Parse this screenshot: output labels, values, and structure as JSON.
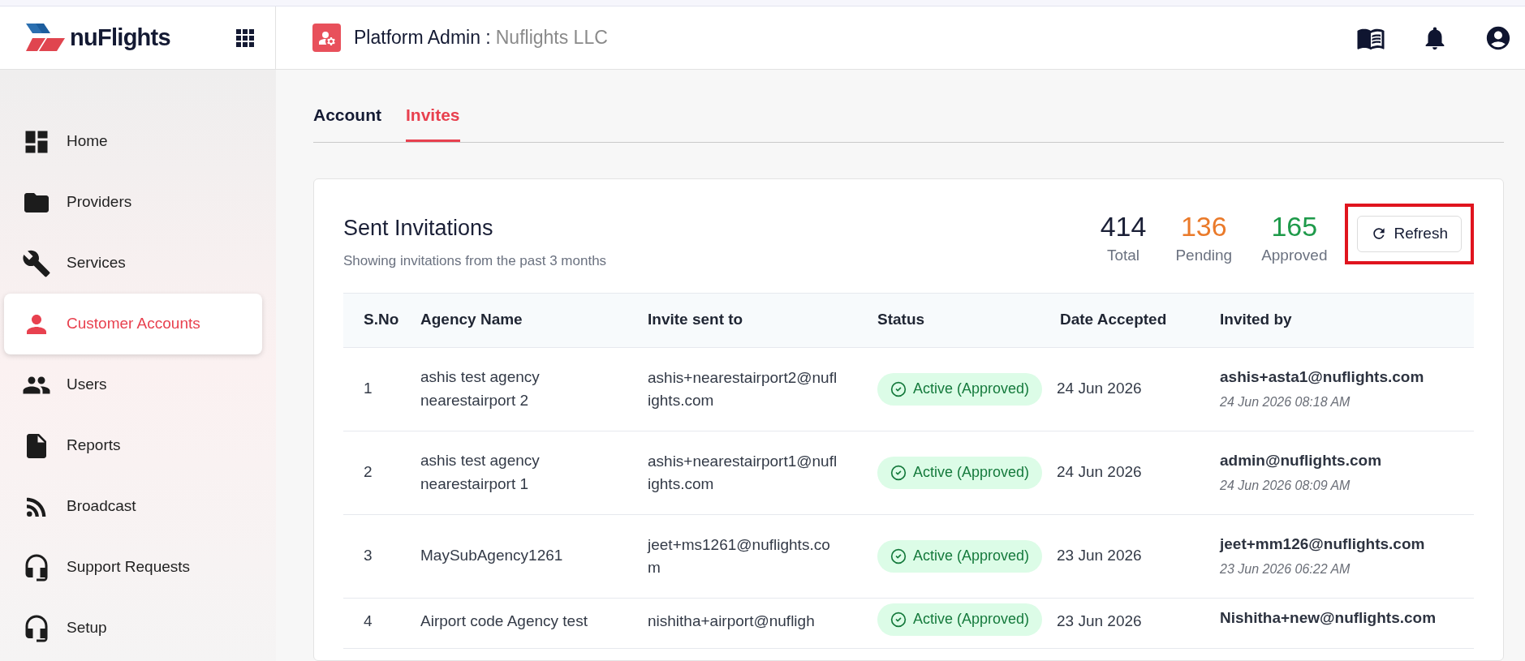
{
  "brand": {
    "name": "nuFlights"
  },
  "header": {
    "title": "Platform Admin :",
    "organization": "Nuflights LLC"
  },
  "sidebar": {
    "items": [
      {
        "label": "Home",
        "selected": false
      },
      {
        "label": "Providers",
        "selected": false
      },
      {
        "label": "Services",
        "selected": false
      },
      {
        "label": "Customer Accounts",
        "selected": true
      },
      {
        "label": "Users",
        "selected": false
      },
      {
        "label": "Reports",
        "selected": false
      },
      {
        "label": "Broadcast",
        "selected": false
      },
      {
        "label": "Support Requests",
        "selected": false
      },
      {
        "label": "Setup",
        "selected": false
      }
    ]
  },
  "tabs": [
    {
      "label": "Account",
      "selected": false
    },
    {
      "label": "Invites",
      "selected": true
    }
  ],
  "card": {
    "title": "Sent Invitations",
    "subtitle": "Showing invitations from the past 3 months",
    "stats": [
      {
        "value": "414",
        "label": "Total",
        "color": "#1a1f36"
      },
      {
        "value": "136",
        "label": "Pending",
        "color": "#ea7a2a"
      },
      {
        "value": "165",
        "label": "Approved",
        "color": "#1e9a4a"
      }
    ],
    "refresh": {
      "label": "Refresh",
      "highlighted": true
    }
  },
  "table": {
    "columns": [
      "S.No",
      "Agency Name",
      "Invite sent to",
      "Status",
      "Date Accepted",
      "Invited by"
    ],
    "rows": [
      {
        "sno": "1",
        "agency": "ashis test agency nearestairport 2",
        "email": "ashis+nearestairport2@nuflights.com",
        "status": "Active (Approved)",
        "date": "24 Jun 2026",
        "invited_by": "ashis+asta1@nuflights.com",
        "invited_at": "24 Jun 2026 08:18 AM"
      },
      {
        "sno": "2",
        "agency": "ashis test agency nearestairport 1",
        "email": "ashis+nearestairport1@nuflights.com",
        "status": "Active (Approved)",
        "date": "24 Jun 2026",
        "invited_by": "admin@nuflights.com",
        "invited_at": "24 Jun 2026 08:09 AM"
      },
      {
        "sno": "3",
        "agency": "MaySubAgency1261",
        "email": "jeet+ms1261@nuflights.com",
        "status": "Active (Approved)",
        "date": "23 Jun 2026",
        "invited_by": "jeet+mm126@nuflights.com",
        "invited_at": "23 Jun 2026 06:22 AM"
      },
      {
        "sno": "4",
        "agency": "Airport code Agency test",
        "email": "nishitha+airport@nufligh",
        "status": "Active (Approved)",
        "date": "23 Jun 2026",
        "invited_by": "Nishitha+new@nuflights.com"
      }
    ]
  }
}
